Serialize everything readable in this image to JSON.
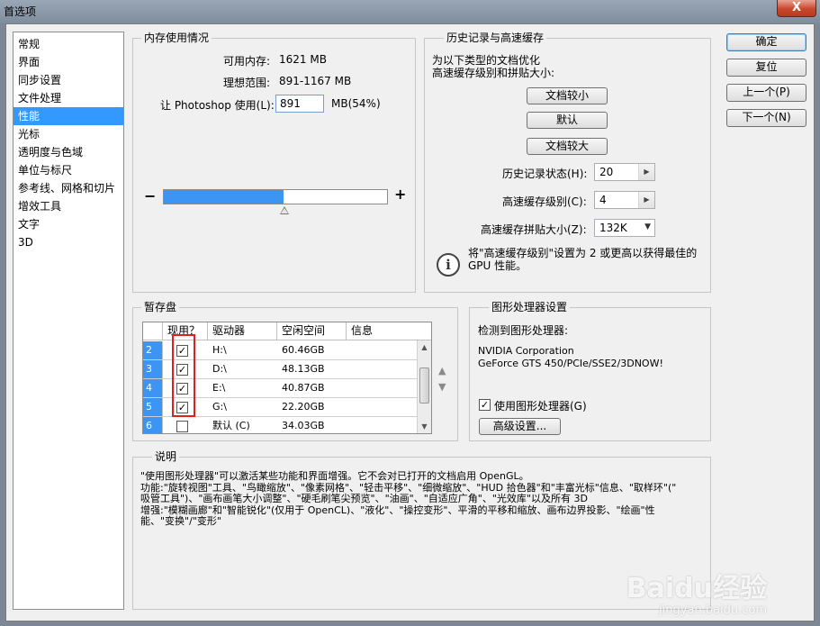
{
  "window": {
    "title": "首选项",
    "close_label": "X"
  },
  "nav": {
    "items": [
      "常规",
      "界面",
      "同步设置",
      "文件处理",
      "性能",
      "光标",
      "透明度与色域",
      "单位与标尺",
      "参考线、网格和切片",
      "增效工具",
      "文字",
      "3D"
    ],
    "active_index": 4
  },
  "memory": {
    "title": "内存使用情况",
    "available_label": "可用内存:",
    "available_value": "1621 MB",
    "ideal_label": "理想范围:",
    "ideal_value": "891-1167 MB",
    "let_label": "让 Photoshop 使用(L):",
    "let_value": "891",
    "unit_label": "MB(54%)",
    "slider_fraction": 0.54,
    "minus": "−",
    "plus": "+"
  },
  "history": {
    "title": "历史记录与高速缓存",
    "desc_line1": "为以下类型的文档优化",
    "desc_line2": "高速缓存级别和拼贴大小:",
    "btn_small": "文档较小",
    "btn_default": "默认",
    "btn_large": "文档较大",
    "states_label": "历史记录状态(H):",
    "states_value": "20",
    "cache_levels_label": "高速缓存级别(C):",
    "cache_levels_value": "4",
    "tile_size_label": "高速缓存拼贴大小(Z):",
    "tile_size_value": "132K",
    "tip_line1": "将\"高速缓存级别\"设置为 2 或更高以获得最佳的",
    "tip_line2": "GPU 性能。"
  },
  "scratch": {
    "title": "暂存盘",
    "headers": [
      "现用？",
      "驱动器",
      "空闲空间",
      "信息"
    ],
    "rows": [
      {
        "num": "2",
        "active": true,
        "drive": "H:\\",
        "free": "60.46GB"
      },
      {
        "num": "3",
        "active": true,
        "drive": "D:\\",
        "free": "48.13GB"
      },
      {
        "num": "4",
        "active": true,
        "drive": "E:\\",
        "free": "40.87GB"
      },
      {
        "num": "5",
        "active": true,
        "drive": "G:\\",
        "free": "22.20GB"
      },
      {
        "num": "6",
        "active": false,
        "drive": "默认 (C)",
        "free": "34.03GB"
      }
    ]
  },
  "gpu": {
    "title": "图形处理器设置",
    "detected_label": "检测到图形处理器:",
    "vendor": "NVIDIA Corporation",
    "model": "GeForce GTS 450/PCIe/SSE2/3DNOW!",
    "use_label": "使用图形处理器(G)",
    "use_checked": true,
    "advanced_button": "高级设置..."
  },
  "description": {
    "title": "说明",
    "lines": [
      "\"使用图形处理器\"可以激活某些功能和界面增强。它不会对已打开的文档启用 OpenGL。",
      "功能:\"旋转视图\"工具、\"鸟瞰缩放\"、\"像素网格\"、\"轻击平移\"、\"细微缩放\"、\"HUD 拾色器\"和\"丰富光标\"信息、\"取样环\"(\"",
      "吸管工具\")、\"画布画笔大小调整\"、\"硬毛刷笔尖预览\"、\"油画\"、\"自适应广角\"、\"光效库\"以及所有 3D",
      "增强:\"模糊画廊\"和\"智能锐化\"(仅用于 OpenCL)、\"液化\"、\"操控变形\"、平滑的平移和缩放、画布边界投影、\"绘画\"性",
      "能、\"变换\"/\"变形\""
    ]
  },
  "buttons": {
    "ok": "确定",
    "reset": "复位",
    "prev": "上一个(P)",
    "next": "下一个(N)"
  },
  "watermark": {
    "brand": "Baidu经验",
    "url": "jingyan.baidu.com"
  }
}
